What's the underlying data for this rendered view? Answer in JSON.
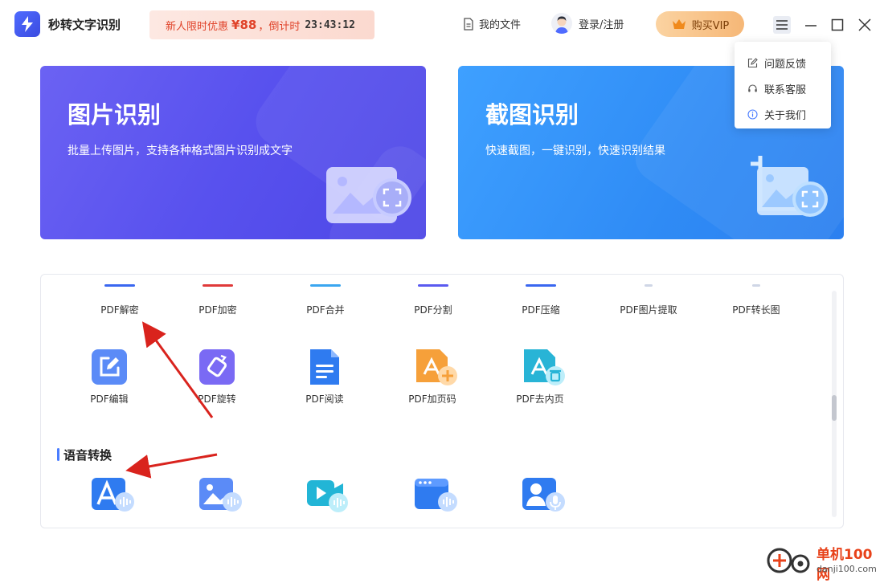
{
  "app": {
    "title": "秒转文字识别"
  },
  "promo": {
    "text": "新人限时优惠",
    "price": "¥88",
    "countdown_label": "，倒计时",
    "countdown": "23:43:12"
  },
  "header": {
    "my_files": "我的文件",
    "login": "登录/注册",
    "vip": "购买VIP"
  },
  "menu": {
    "items": [
      {
        "label": "问题反馈",
        "icon": "edit-icon"
      },
      {
        "label": "联系客服",
        "icon": "headset-icon"
      },
      {
        "label": "关于我们",
        "icon": "info-icon"
      }
    ]
  },
  "cards": {
    "image": {
      "title": "图片识别",
      "subtitle": "批量上传图片，支持各种格式图片识别成文字"
    },
    "screenshot": {
      "title": "截图识别",
      "subtitle": "快速截图，一键识别，快速识别结果"
    }
  },
  "tools": {
    "row1": [
      "PDF解密",
      "PDF加密",
      "PDF合并",
      "PDF分割",
      "PDF压缩",
      "PDF图片提取",
      "PDF转长图"
    ],
    "row2": [
      "PDF编辑",
      "PDF旋转",
      "PDF阅读",
      "PDF加页码",
      "PDF去内页"
    ]
  },
  "sections": {
    "voice": "语音转换"
  },
  "watermark": {
    "title": "单机100网",
    "url": "danji100.com"
  },
  "colors": {
    "image_card": "#5851ee",
    "screenshot_card": "#2f8bf5",
    "promo_text": "#e0432a",
    "vip_gradient_start": "#fbd3a1",
    "annotation_arrow": "#d9231d"
  }
}
